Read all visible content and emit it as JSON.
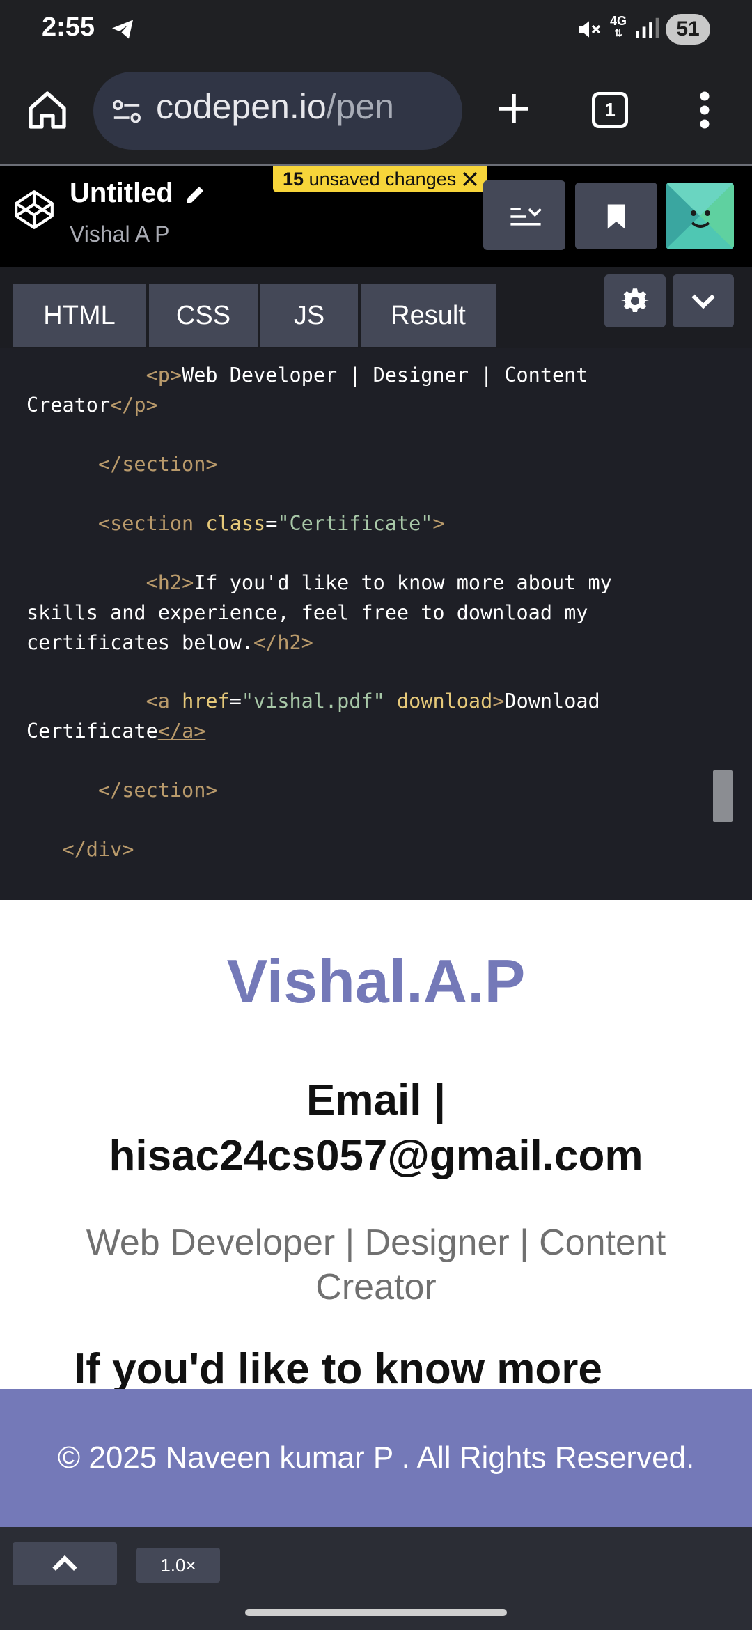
{
  "status_bar": {
    "time": "2:55",
    "network": "4G",
    "battery": "51"
  },
  "browser": {
    "url_domain": "codepen.io",
    "url_path": "/pen",
    "tab_count": "1"
  },
  "codepen": {
    "title": "Untitled",
    "author": "Vishal A P",
    "unsaved_count": "15",
    "unsaved_label": "unsaved changes"
  },
  "tabs": [
    {
      "label": "HTML"
    },
    {
      "label": "CSS"
    },
    {
      "label": "JS"
    },
    {
      "label": "Result"
    }
  ],
  "code": {
    "l1_text": "Web Developer | Designer | Content",
    "l2_text": "Creator",
    "l3_close": "</section>",
    "l4_attr_name": "class",
    "l4_attr_value": "\"Certificate\"",
    "l5_text": "If you'd like to know more about my",
    "l6_text": "skills and experience, feel free to download my",
    "l7_text": "certificates below.",
    "l8_attr_name": "href",
    "l8_attr_value": "\"vishal.pdf\"",
    "l8_attr2": "download",
    "l8_text": "Download",
    "l9_text": "Certificate",
    "l10_close": "</section>",
    "l11_close": "</div>"
  },
  "preview": {
    "name": "Vishal.A.P",
    "email_line1": "Email |",
    "email_line2": "hisac24cs057@gmail.com",
    "role_line1": "Web Developer | Designer | Content",
    "role_line2": "Creator",
    "section_heading": "If you'd like to know more",
    "footer": "© 2025 Naveen kumar P . All Rights Reserved."
  },
  "bottom_bar": {
    "zoom": "1.0×"
  },
  "colors": {
    "accent": "#7479b8",
    "unsaved_badge": "#f7d53a",
    "button_bg": "#444857"
  },
  "icons": [
    "telegram-icon",
    "mute-icon",
    "signal-icon",
    "home-icon",
    "site-settings-icon",
    "plus-icon",
    "overflow-menu-icon",
    "codepen-logo-icon",
    "pencil-icon",
    "close-icon",
    "layout-icon",
    "bookmark-icon",
    "gear-icon",
    "chevron-down-icon",
    "chevron-up-icon"
  ]
}
